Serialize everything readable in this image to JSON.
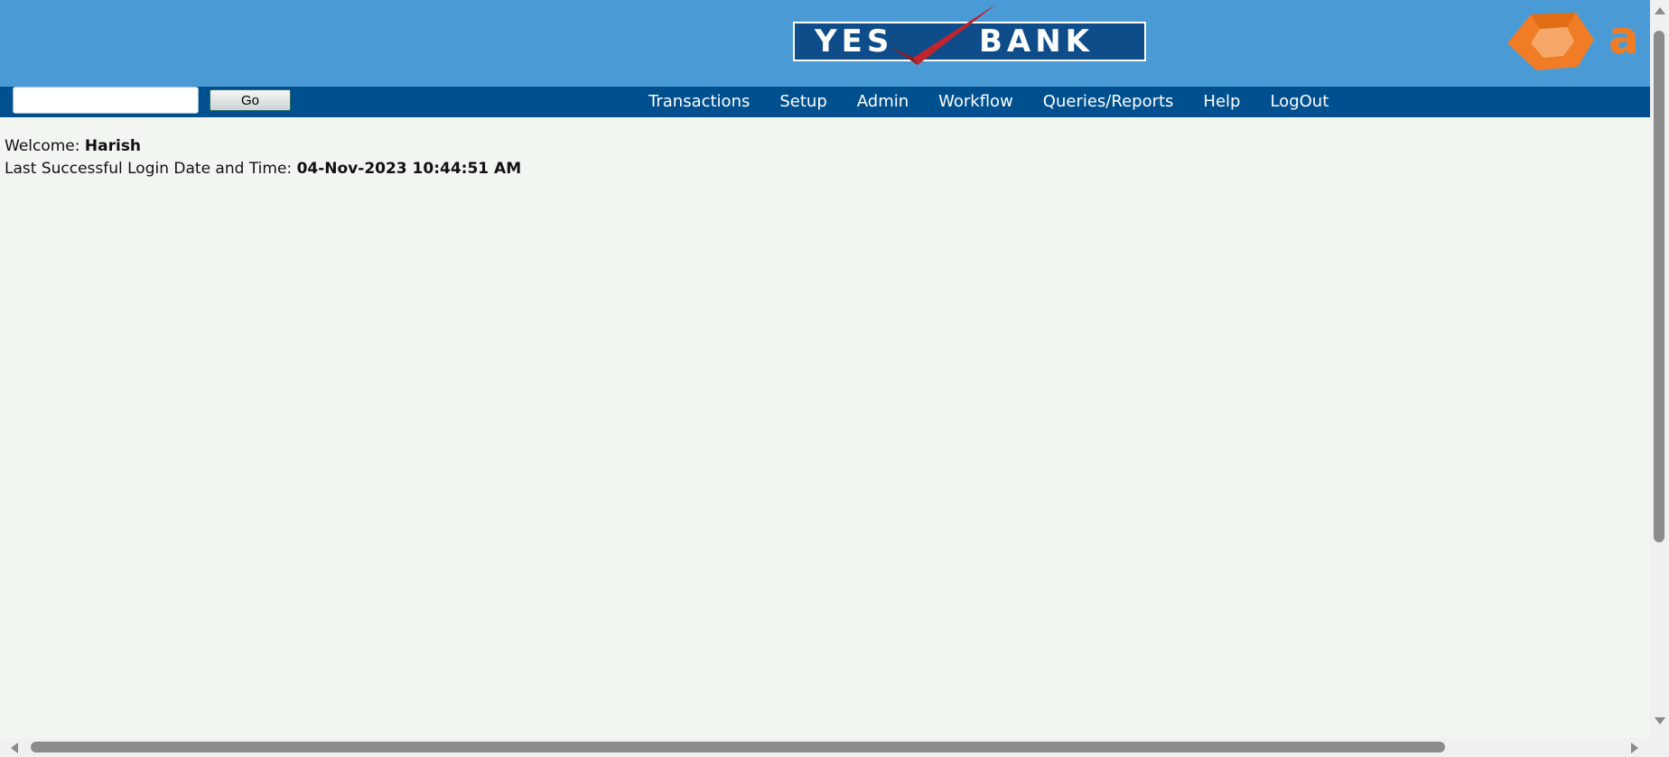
{
  "header": {
    "logo": {
      "word1": "YES",
      "word2": "BANK"
    },
    "partner_logo_text": "a",
    "colors": {
      "header_bg": "#4a9bd5",
      "logo_bg": "#0f4d8a",
      "check_red": "#c0242c",
      "partner_orange": "#f07d26"
    }
  },
  "navbar": {
    "search": {
      "value": "",
      "placeholder": ""
    },
    "go_label": "Go",
    "menu": [
      {
        "label": "Transactions"
      },
      {
        "label": "Setup"
      },
      {
        "label": "Admin"
      },
      {
        "label": "Workflow"
      },
      {
        "label": "Queries/Reports"
      },
      {
        "label": "Help"
      },
      {
        "label": "LogOut"
      }
    ],
    "colors": {
      "navbar_bg": "#00508f"
    }
  },
  "main": {
    "welcome_label": "Welcome:",
    "user_name": "Harish",
    "last_login_label": "Last Successful Login Date and Time:",
    "last_login_value": "04-Nov-2023 10:44:51 AM"
  }
}
